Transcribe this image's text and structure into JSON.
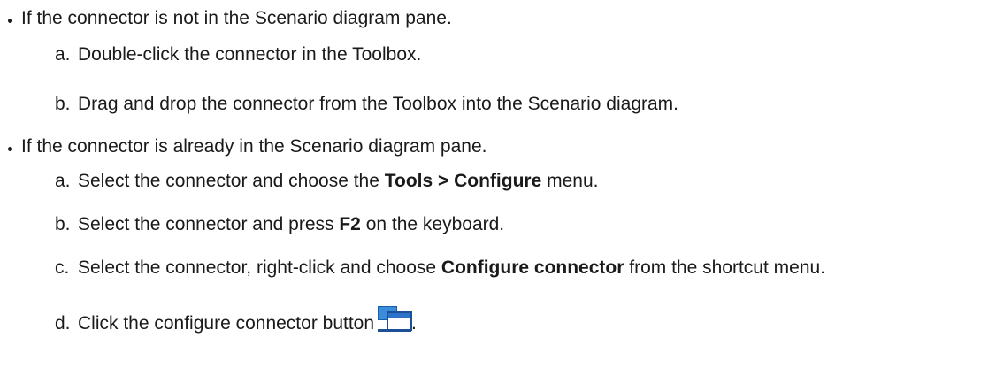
{
  "section1": {
    "heading": "If the connector is not in the Scenario diagram pane.",
    "steps": [
      {
        "marker": "a.",
        "text": "Double-click the connector in the Toolbox."
      },
      {
        "marker": "b.",
        "text": "Drag and drop the connector from the Toolbox into the Scenario diagram."
      }
    ]
  },
  "section2": {
    "heading": "If the connector is already in the Scenario diagram pane.",
    "steps": [
      {
        "marker": "a.",
        "pre": "Select the connector and choose the ",
        "bold": "Tools > Configure",
        "post": " menu."
      },
      {
        "marker": "b.",
        "pre": "Select the connector and press ",
        "bold": "F2",
        "post": " on the keyboard."
      },
      {
        "marker": "c.",
        "pre": "Select the connector, right-click and choose ",
        "bold": "Configure connector",
        "post": " from the shortcut menu."
      },
      {
        "marker": "d.",
        "pre": "Click the configure connector button",
        "post": "."
      }
    ]
  },
  "icons": {
    "bullet": "bullet-dot-icon",
    "configure": "configure-connector-icon"
  }
}
